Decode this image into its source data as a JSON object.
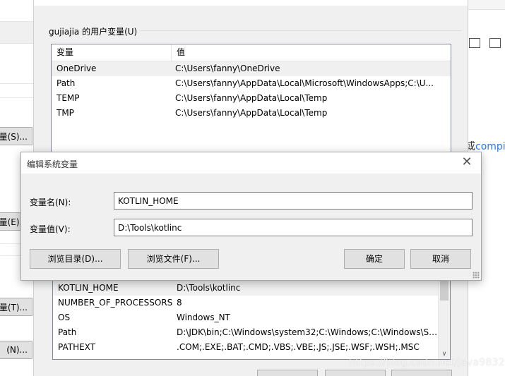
{
  "background_left": {
    "buttons": [
      {
        "label": "量(S)..."
      },
      {
        "label": "量(E)..."
      },
      {
        "label": "量(T)..."
      },
      {
        "label": "(N)..."
      }
    ]
  },
  "background_right": {
    "link_prefix": "或",
    "link_text": "compi"
  },
  "env_window": {
    "user_group_title": "gujiajia 的用户变量(U)",
    "columns": [
      "变量",
      "值"
    ],
    "user_vars": [
      {
        "name": "OneDrive",
        "value": "C:\\Users\\fanny\\OneDrive"
      },
      {
        "name": "Path",
        "value": "C:\\Users\\fanny\\AppData\\Local\\Microsoft\\WindowsApps;C:\\U..."
      },
      {
        "name": "TEMP",
        "value": "C:\\Users\\fanny\\AppData\\Local\\Temp"
      },
      {
        "name": "TMP",
        "value": "C:\\Users\\fanny\\AppData\\Local\\Temp"
      }
    ],
    "system_vars": [
      {
        "name": "KOTLIN_HOME",
        "value": "D:\\Tools\\kotlinc"
      },
      {
        "name": "NUMBER_OF_PROCESSORS",
        "value": "8"
      },
      {
        "name": "OS",
        "value": "Windows_NT"
      },
      {
        "name": "Path",
        "value": "D:\\JDK\\bin;C:\\Windows\\system32;C:\\Windows;C:\\Windows\\Sy..."
      },
      {
        "name": "PATHEXT",
        "value": ".COM;.EXE;.BAT;.CMD;.VBS;.VBE;.JS;.JSE;.WSF;.WSH;.MSC"
      }
    ]
  },
  "dialog": {
    "title": "编辑系统变量",
    "name_label": "变量名(N):",
    "name_value": "KOTLIN_HOME",
    "value_label": "变量值(V):",
    "value_value": "D:\\Tools\\kotlinc",
    "browse_dir": "浏览目录(D)...",
    "browse_file": "浏览文件(F)...",
    "ok": "确定",
    "cancel": "取消"
  },
  "watermark": "https://blog.csdn.net/java9832"
}
